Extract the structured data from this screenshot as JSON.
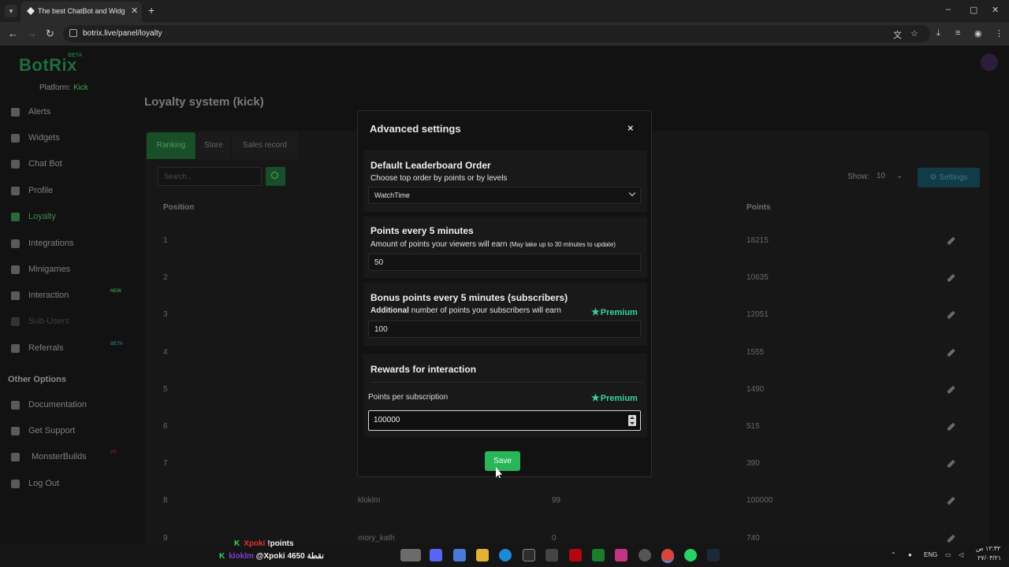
{
  "browser": {
    "tab_title": "The best ChatBot and Widgets",
    "tab_close": "✕",
    "new_tab": "+",
    "url": "botrix.live/panel/loyalty",
    "window_controls": [
      "–",
      "▢",
      "✕"
    ]
  },
  "app": {
    "logo": "BotRix",
    "logo_badge": "BETA",
    "platform_label": "Platform:",
    "platform_value": "Kick",
    "accent_color": "#2bb55a"
  },
  "sidebar": {
    "items": [
      {
        "label": "Alerts",
        "icon": "alert-icon"
      },
      {
        "label": "Widgets",
        "icon": "widgets-icon"
      },
      {
        "label": "Chat Bot",
        "icon": "chatbot-icon"
      },
      {
        "label": "Profile",
        "icon": "profile-icon"
      },
      {
        "label": "Loyalty",
        "icon": "trophy-icon",
        "active": true
      },
      {
        "label": "Integrations",
        "icon": "integrations-icon"
      },
      {
        "label": "Minigames",
        "icon": "gamepad-icon"
      },
      {
        "label": "Interaction",
        "icon": "music-icon",
        "badge": "NEW"
      },
      {
        "label": "Sub-Users",
        "icon": "users-icon"
      },
      {
        "label": "Referrals",
        "icon": "referrals-icon",
        "badge": "BETA"
      }
    ],
    "other_title": "Other Options",
    "other_items": [
      {
        "label": "Documentation",
        "icon": "document-icon"
      },
      {
        "label": "Get Support",
        "icon": "support-icon"
      },
      {
        "label": "MonsterBuilds",
        "icon": "monitor-icon",
        "badge": "PC"
      },
      {
        "label": "Log Out",
        "icon": "logout-icon"
      }
    ]
  },
  "main": {
    "title": "Loyalty system (kick)",
    "tabs": [
      "Ranking",
      "Store",
      "Sales record"
    ],
    "search_placeholder": "Search...",
    "show_label": "Show:",
    "show_value": "10",
    "settings_label": "Settings",
    "columns": [
      "Position",
      "Points"
    ],
    "rows": [
      {
        "position": "1",
        "user": "",
        "value": "",
        "points": "18215"
      },
      {
        "position": "2",
        "user": "",
        "value": "",
        "points": "10635"
      },
      {
        "position": "3",
        "user": "",
        "value": "",
        "points": "12051"
      },
      {
        "position": "4",
        "user": "",
        "value": "",
        "points": "1555"
      },
      {
        "position": "5",
        "user": "",
        "value": "",
        "points": "1490"
      },
      {
        "position": "6",
        "user": "",
        "value": "",
        "points": "515"
      },
      {
        "position": "7",
        "user": "",
        "value": "",
        "points": "390"
      },
      {
        "position": "8",
        "user": "kloklm",
        "value": "99",
        "points": "100000"
      },
      {
        "position": "9",
        "user": "mory_kath",
        "value": "0",
        "points": "740"
      }
    ]
  },
  "modal": {
    "title": "Advanced settings",
    "close": "×",
    "leaderboard": {
      "heading": "Default Leaderboard Order",
      "description": "Choose top order by points or by levels",
      "selected": "WatchTime"
    },
    "points": {
      "heading": "Points every 5 minutes",
      "description": "Amount of points your viewers will earn",
      "note": "(May take up to 30 minutes to update)",
      "value": "50"
    },
    "bonus": {
      "heading": "Bonus points every 5 minutes (subscribers)",
      "description_bold": "Additional",
      "description": "number of points your subscribers will earn",
      "premium": "Premium",
      "value": "100"
    },
    "rewards": {
      "heading": "Rewards for interaction",
      "subscription_label": "Points per subscription",
      "premium": "Premium",
      "value": "100000"
    },
    "save_label": "Save"
  },
  "chat_overlay": [
    {
      "user": "Xpoki",
      "message": "!points",
      "user_color": "#e0332e"
    },
    {
      "user": "kloklm",
      "message": "@Xpoki 4650 نقطة",
      "user_color": "#7e3fd6"
    }
  ],
  "taskbar": {
    "language": "ENG",
    "time": "١٢:٣٢ ص",
    "date": "٢٧/٠٣/٢١"
  }
}
